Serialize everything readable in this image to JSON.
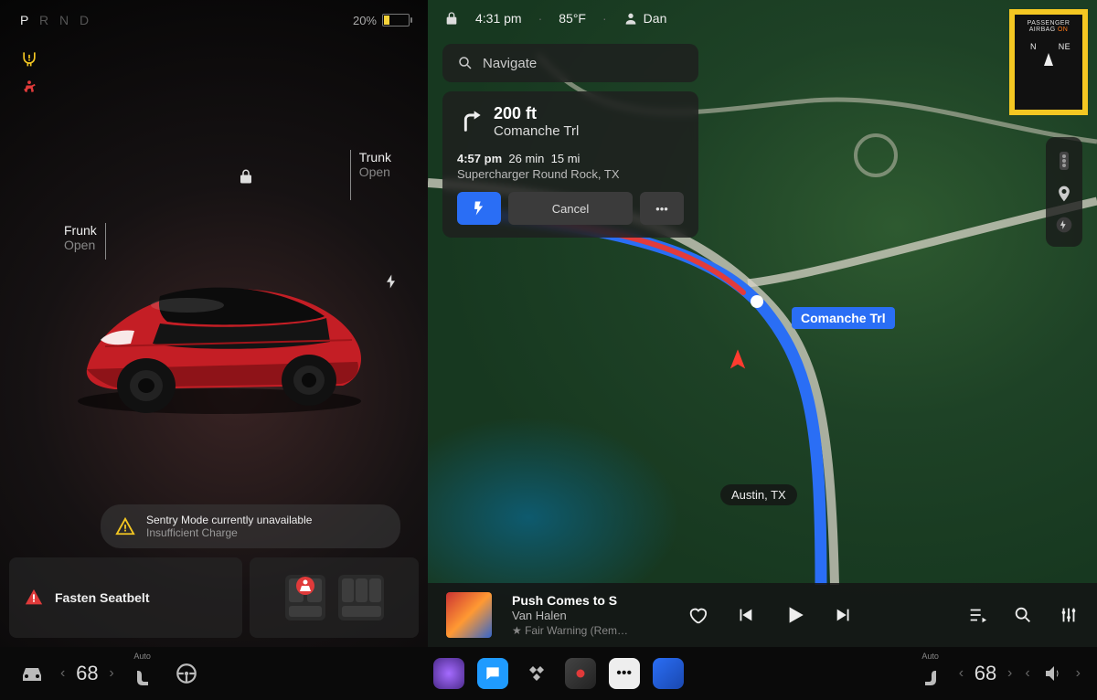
{
  "gear": {
    "letters": [
      "P",
      "R",
      "N",
      "D"
    ],
    "active": "P"
  },
  "battery": {
    "percent": "20%",
    "fill_pct": 20,
    "color": "#f4d23a"
  },
  "callouts": {
    "trunk": {
      "label": "Trunk",
      "action": "Open"
    },
    "frunk": {
      "label": "Frunk",
      "action": "Open"
    }
  },
  "sentry": {
    "title": "Sentry Mode currently unavailable",
    "sub": "Insufficient Charge"
  },
  "seatbelt": {
    "text": "Fasten Seatbelt"
  },
  "statusbar": {
    "time": "4:31 pm",
    "temp": "85°F",
    "profile": "Dan"
  },
  "search": {
    "placeholder": "Navigate"
  },
  "directions": {
    "distance": "200 ft",
    "street": "Comanche Trl",
    "eta": "4:57 pm",
    "duration": "26 min",
    "miles": "15 mi",
    "dest": "Supercharger Round Rock, TX",
    "cancel": "Cancel"
  },
  "airbag": {
    "l1": "PASSENGER",
    "l2": "AIRBAG",
    "state": "ON",
    "dir1": "N",
    "dir2": "NE"
  },
  "map": {
    "road": "Comanche Trl",
    "city": "Austin, TX"
  },
  "media": {
    "title": "Push Comes to S",
    "artist": "Van Halen",
    "album": "Fair Warning (Rem…"
  },
  "dock": {
    "left_temp": "68",
    "right_temp": "68",
    "seat_auto": "Auto"
  }
}
